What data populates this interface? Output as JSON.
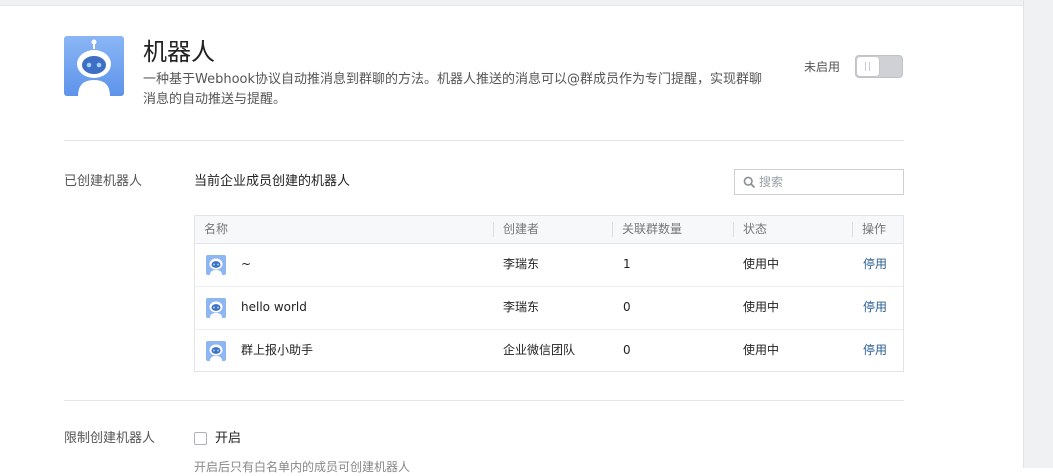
{
  "app": {
    "title": "机器人",
    "description": "一种基于Webhook协议自动推消息到群聊的方法。机器人推送的消息可以@群成员作为专门提醒，实现群聊消息的自动推送与提醒。",
    "status_label": "未启用",
    "enabled": false,
    "icon": "robot-icon"
  },
  "created_section": {
    "label": "已创建机器人",
    "subtitle": "当前企业成员创建的机器人",
    "search_placeholder": "搜索",
    "search_icon": "search-icon",
    "columns": [
      "名称",
      "创建者",
      "关联群数量",
      "状态",
      "操作"
    ],
    "rows": [
      {
        "name": "~",
        "creator": "李瑞东",
        "groups": "1",
        "status": "使用中",
        "action": "停用"
      },
      {
        "name": "hello world",
        "creator": "李瑞东",
        "groups": "0",
        "status": "使用中",
        "action": "停用"
      },
      {
        "name": "群上报小助手",
        "creator": "企业微信团队",
        "groups": "0",
        "status": "使用中",
        "action": "停用"
      }
    ]
  },
  "restrict_section": {
    "label": "限制创建机器人",
    "checkbox_label": "开启",
    "checked": false,
    "hint": "开启后只有白名单内的成员可创建机器人"
  },
  "colors": {
    "link": "#2a5e93",
    "icon_blue": "#6c9df0",
    "toggle_off": "#cfd1d4"
  }
}
